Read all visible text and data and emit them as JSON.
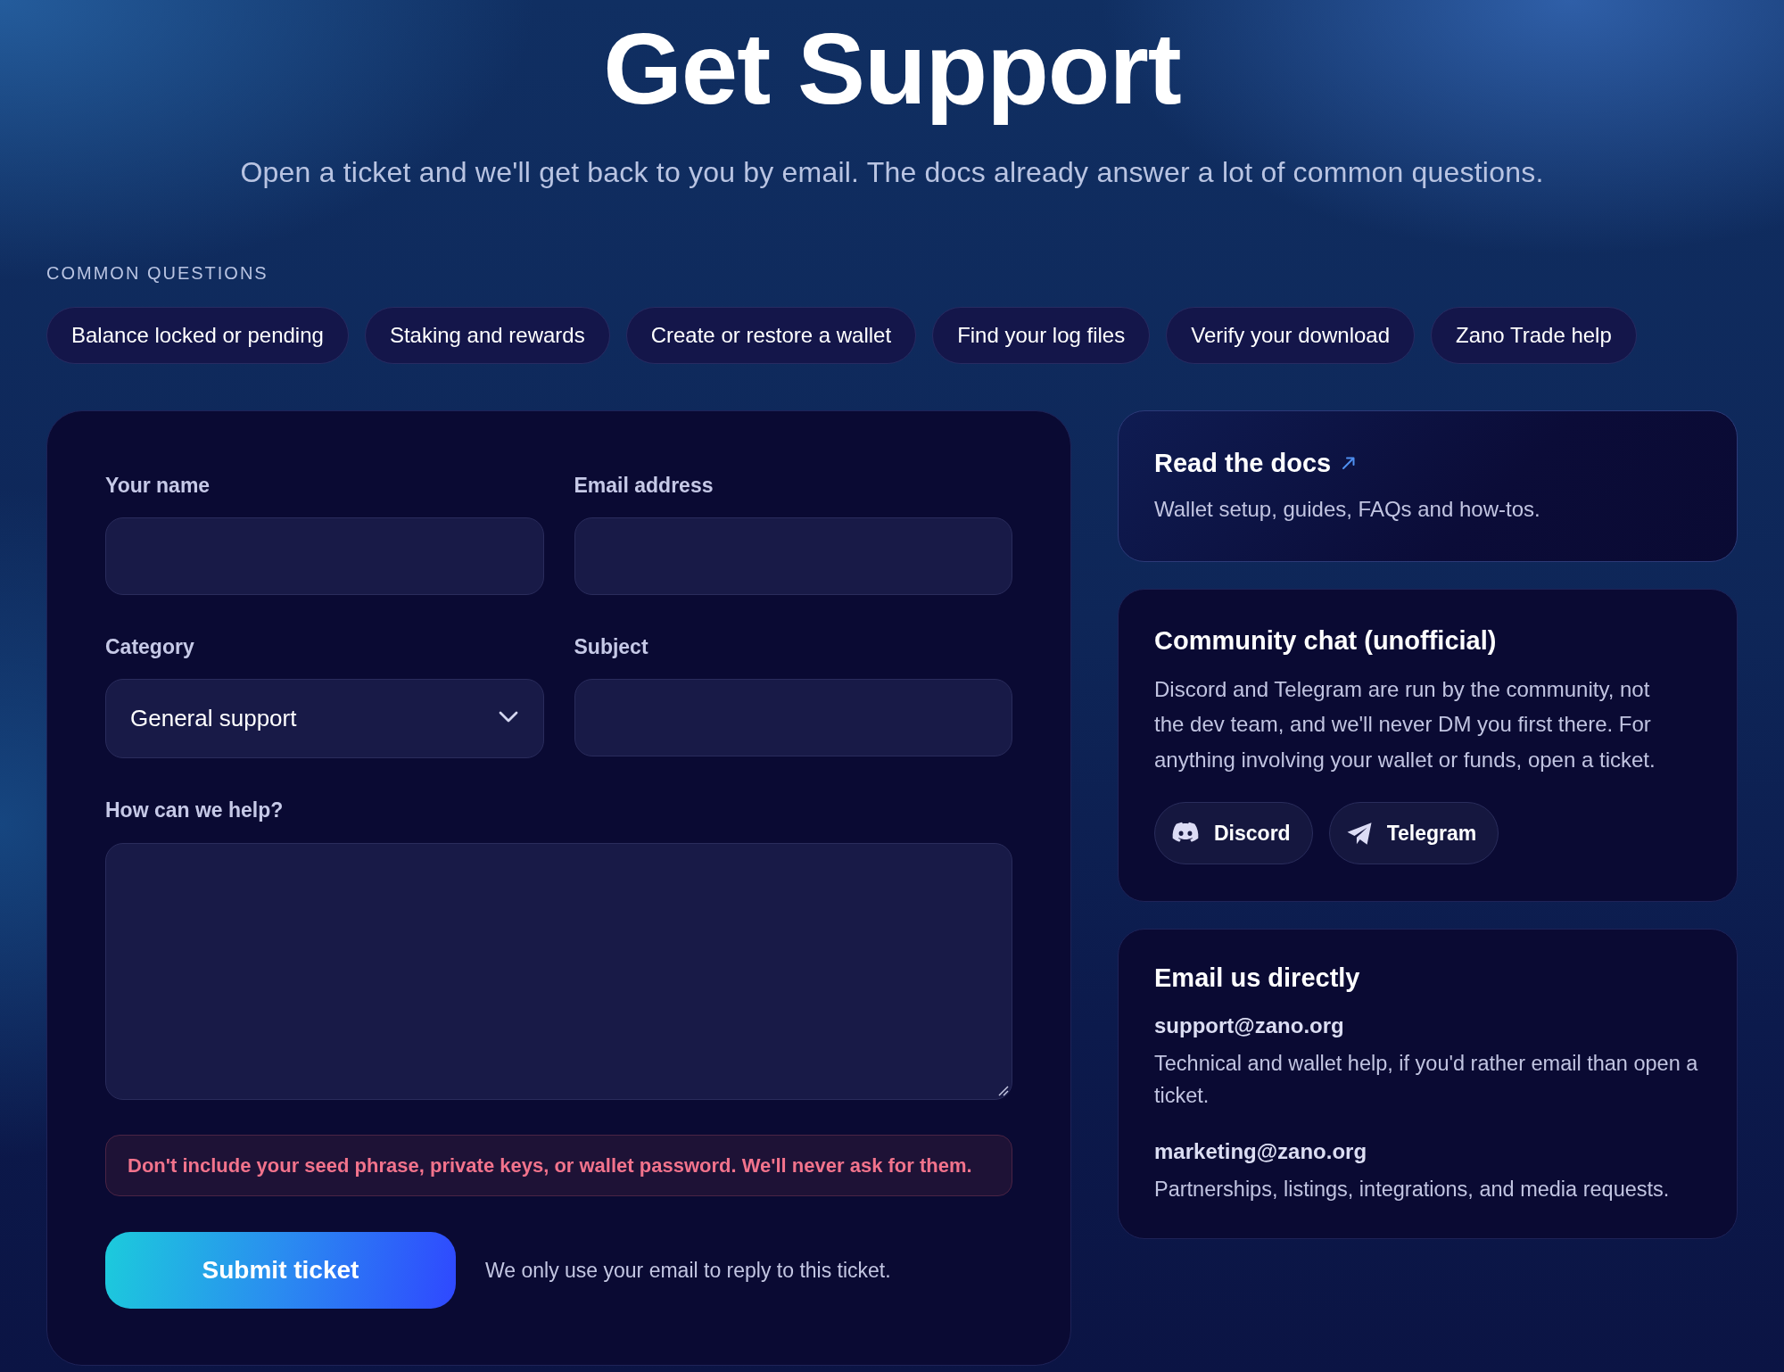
{
  "header": {
    "title": "Get Support",
    "subtitle": "Open a ticket and we'll get back to you by email. The docs already answer a lot of common questions."
  },
  "common_questions": {
    "heading": "COMMON QUESTIONS",
    "chips": [
      "Balance locked or pending",
      "Staking and rewards",
      "Create or restore a wallet",
      "Find your log files",
      "Verify your download",
      "Zano Trade help"
    ]
  },
  "ticket_form": {
    "fields": [
      {
        "kind": "input",
        "label": "Your name"
      },
      {
        "kind": "input",
        "label": "Email address"
      },
      {
        "kind": "select",
        "label": "Category",
        "value": "General support"
      },
      {
        "kind": "input",
        "label": "Subject"
      },
      {
        "kind": "textarea",
        "label": "How can we help?"
      }
    ],
    "warning": "Don't include your seed phrase, private keys, or wallet password. We'll never ask for them.",
    "submit_button": "Submit ticket",
    "note": "We only use your email to reply to this ticket."
  },
  "docs_card": {
    "title": "Read the docs",
    "description": "Wallet setup, guides, FAQs and how-tos."
  },
  "community_card": {
    "title": "Community chat (unofficial)",
    "description": "Discord and Telegram are run by the community, not the dev team, and we'll never DM you first there. For anything involving your wallet or funds, open a ticket.",
    "buttons": [
      {
        "kind": "discord",
        "label": "Discord"
      },
      {
        "kind": "telegram",
        "label": "Telegram"
      }
    ]
  },
  "email_card": {
    "title": "Email us directly",
    "contacts": [
      {
        "address": "support@zano.org",
        "description": "Technical and wallet help, if you'd rather email than open a ticket."
      },
      {
        "address": "marketing@zano.org",
        "description": "Partnerships, listings, integrations, and media requests."
      }
    ]
  }
}
